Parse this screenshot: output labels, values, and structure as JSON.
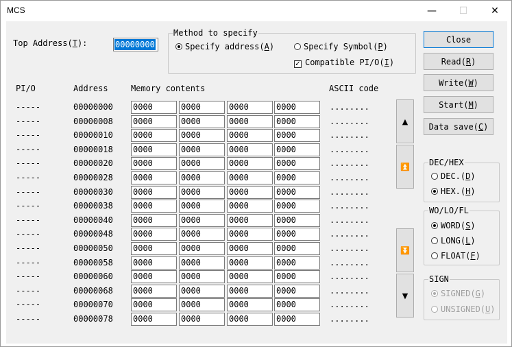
{
  "window": {
    "title": "MCS",
    "minimize": "—",
    "maximize": "☐",
    "close": "✕"
  },
  "top_address": {
    "label_pre": "Top Address(",
    "label_key": "T",
    "label_post": "):",
    "value": "00000000"
  },
  "method": {
    "legend": "Method to specify",
    "specify_address": {
      "pre": "Specify address(",
      "key": "A",
      "post": ")",
      "selected": true
    },
    "specify_symbol": {
      "pre": "Specify Symbol(",
      "key": "P",
      "post": ")",
      "selected": false
    },
    "compatible": {
      "pre": "Compatible PI/O(",
      "key": "I",
      "post": ")",
      "checked": true
    }
  },
  "columns": {
    "pio": "PI/O",
    "address": "Address",
    "memory": "Memory contents",
    "ascii": "ASCII code"
  },
  "rows": [
    {
      "pio": "-----",
      "address": "00000000",
      "cells": [
        "0000",
        "0000",
        "0000",
        "0000"
      ],
      "ascii": "........"
    },
    {
      "pio": "-----",
      "address": "00000008",
      "cells": [
        "0000",
        "0000",
        "0000",
        "0000"
      ],
      "ascii": "........"
    },
    {
      "pio": "-----",
      "address": "00000010",
      "cells": [
        "0000",
        "0000",
        "0000",
        "0000"
      ],
      "ascii": "........"
    },
    {
      "pio": "-----",
      "address": "00000018",
      "cells": [
        "0000",
        "0000",
        "0000",
        "0000"
      ],
      "ascii": "........"
    },
    {
      "pio": "-----",
      "address": "00000020",
      "cells": [
        "0000",
        "0000",
        "0000",
        "0000"
      ],
      "ascii": "........"
    },
    {
      "pio": "-----",
      "address": "00000028",
      "cells": [
        "0000",
        "0000",
        "0000",
        "0000"
      ],
      "ascii": "........"
    },
    {
      "pio": "-----",
      "address": "00000030",
      "cells": [
        "0000",
        "0000",
        "0000",
        "0000"
      ],
      "ascii": "........"
    },
    {
      "pio": "-----",
      "address": "00000038",
      "cells": [
        "0000",
        "0000",
        "0000",
        "0000"
      ],
      "ascii": "........"
    },
    {
      "pio": "-----",
      "address": "00000040",
      "cells": [
        "0000",
        "0000",
        "0000",
        "0000"
      ],
      "ascii": "........"
    },
    {
      "pio": "-----",
      "address": "00000048",
      "cells": [
        "0000",
        "0000",
        "0000",
        "0000"
      ],
      "ascii": "........"
    },
    {
      "pio": "-----",
      "address": "00000050",
      "cells": [
        "0000",
        "0000",
        "0000",
        "0000"
      ],
      "ascii": "........"
    },
    {
      "pio": "-----",
      "address": "00000058",
      "cells": [
        "0000",
        "0000",
        "0000",
        "0000"
      ],
      "ascii": "........"
    },
    {
      "pio": "-----",
      "address": "00000060",
      "cells": [
        "0000",
        "0000",
        "0000",
        "0000"
      ],
      "ascii": "........"
    },
    {
      "pio": "-----",
      "address": "00000068",
      "cells": [
        "0000",
        "0000",
        "0000",
        "0000"
      ],
      "ascii": "........"
    },
    {
      "pio": "-----",
      "address": "00000070",
      "cells": [
        "0000",
        "0000",
        "0000",
        "0000"
      ],
      "ascii": "........"
    },
    {
      "pio": "-----",
      "address": "00000078",
      "cells": [
        "0000",
        "0000",
        "0000",
        "0000"
      ],
      "ascii": "........"
    }
  ],
  "scroll": {
    "up": "▲",
    "page_up": "⏫",
    "page_down": "⏬",
    "down": "▼"
  },
  "buttons": {
    "close": {
      "pre": "Close",
      "key": "",
      "post": ""
    },
    "read": {
      "pre": "Read(",
      "key": "R",
      "post": ")"
    },
    "write": {
      "pre": "Write(",
      "key": "W",
      "post": ")"
    },
    "start": {
      "pre": "Start(",
      "key": "M",
      "post": ")"
    },
    "data_save": {
      "pre": "Data save(",
      "key": "C",
      "post": ")"
    }
  },
  "dec_hex": {
    "legend": "DEC/HEX",
    "dec": {
      "pre": "DEC.(",
      "key": "D",
      "post": ")",
      "selected": false
    },
    "hex": {
      "pre": "HEX.(",
      "key": "H",
      "post": ")",
      "selected": true
    }
  },
  "size": {
    "legend": "WO/LO/FL",
    "word": {
      "pre": "WORD(",
      "key": "S",
      "post": ")",
      "selected": true
    },
    "long": {
      "pre": "LONG(",
      "key": "L",
      "post": ")",
      "selected": false
    },
    "float": {
      "pre": "FLOAT(",
      "key": "F",
      "post": ")",
      "selected": false
    }
  },
  "sign": {
    "legend": "SIGN",
    "signed": {
      "pre": "SIGNED(",
      "key": "G",
      "post": ")",
      "selected": true
    },
    "unsigned": {
      "pre": "UNSIGNED(",
      "key": "U",
      "post": ")",
      "selected": false
    }
  },
  "colors": {
    "accent": "#0078d7",
    "face": "#f0f0f0",
    "button": "#e1e1e1",
    "disabled": "#a0a0a0"
  }
}
